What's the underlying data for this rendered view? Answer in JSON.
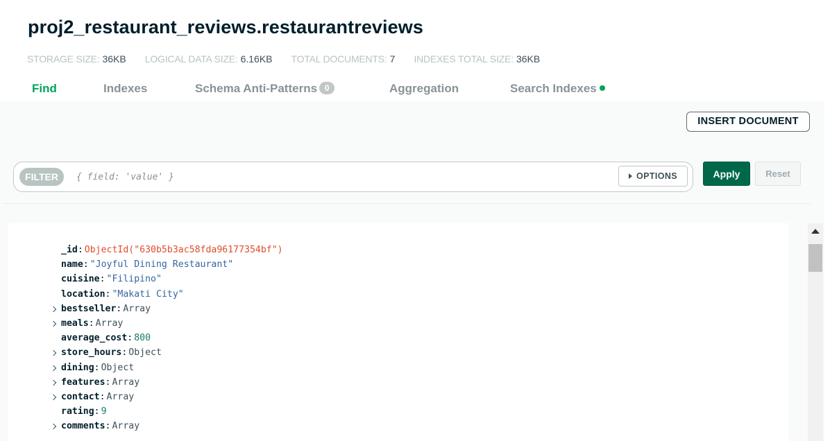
{
  "header": {
    "namespace": "proj2_restaurant_reviews.restaurantreviews"
  },
  "stats": [
    {
      "label": "STORAGE SIZE:",
      "value": "36KB"
    },
    {
      "label": "LOGICAL DATA SIZE:",
      "value": "6.16KB"
    },
    {
      "label": "TOTAL DOCUMENTS:",
      "value": "7"
    },
    {
      "label": "INDEXES TOTAL SIZE:",
      "value": "36KB"
    }
  ],
  "tabs": {
    "find": "Find",
    "indexes": "Indexes",
    "schema": "Schema Anti-Patterns",
    "schema_badge": "0",
    "aggregation": "Aggregation",
    "search": "Search Indexes"
  },
  "toolbar": {
    "insert_label": "INSERT DOCUMENT"
  },
  "filter": {
    "pill_label": "FILTER",
    "placeholder": "{ field: 'value' }",
    "options_label": "OPTIONS",
    "apply_label": "Apply",
    "reset_label": "Reset"
  },
  "document": {
    "fields": [
      {
        "key": "_id",
        "value": "ObjectId(\"630b5b3ac58fda96177354bf\")",
        "kind": "oid",
        "expandable": false
      },
      {
        "key": "name",
        "value": "\"Joyful Dining Restaurant\"",
        "kind": "str",
        "expandable": false
      },
      {
        "key": "cuisine",
        "value": "\"Filipino\"",
        "kind": "str",
        "expandable": false
      },
      {
        "key": "location",
        "value": "\"Makati City\"",
        "kind": "str",
        "expandable": false
      },
      {
        "key": "bestseller",
        "value": "Array",
        "kind": "type",
        "expandable": true
      },
      {
        "key": "meals",
        "value": "Array",
        "kind": "type",
        "expandable": true
      },
      {
        "key": "average_cost",
        "value": "800",
        "kind": "num",
        "expandable": false
      },
      {
        "key": "store_hours",
        "value": "Object",
        "kind": "type",
        "expandable": true
      },
      {
        "key": "dining",
        "value": "Object",
        "kind": "type",
        "expandable": true
      },
      {
        "key": "features",
        "value": "Array",
        "kind": "type",
        "expandable": true
      },
      {
        "key": "contact",
        "value": "Array",
        "kind": "type",
        "expandable": true
      },
      {
        "key": "rating",
        "value": "9",
        "kind": "num",
        "expandable": false
      },
      {
        "key": "comments",
        "value": "Array",
        "kind": "type",
        "expandable": true
      }
    ]
  },
  "colors": {
    "accent_green": "#00a35c",
    "apply_green": "#00684a",
    "oid_red": "#e04c2c",
    "string_blue": "#3365a0"
  }
}
